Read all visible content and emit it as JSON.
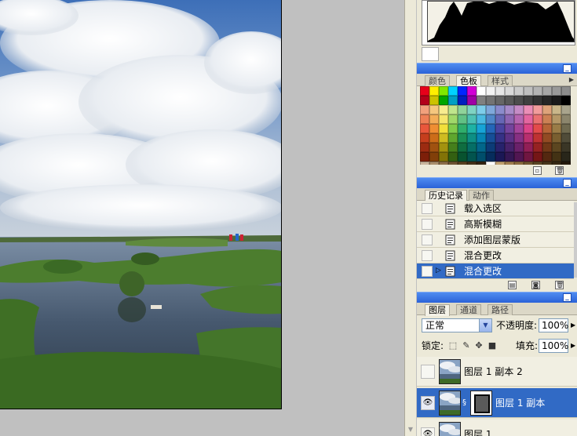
{
  "panels": {
    "swatches": {
      "tabs": [
        "颜色",
        "色板",
        "样式"
      ],
      "active_tab": 1,
      "colors": [
        "#e6001a",
        "#ffee00",
        "#7fe800",
        "#00d2ff",
        "#0026ff",
        "#d100d6",
        "#ffffff",
        "#f2f2f2",
        "#e6e6e6",
        "#d9d9d9",
        "#cccccc",
        "#bfbfbf",
        "#b3b3b3",
        "#a6a6a6",
        "#999999",
        "#8c8c8c",
        "#b3001a",
        "#ccc200",
        "#00a600",
        "#009fc4",
        "#001ebf",
        "#a000a6",
        "#808080",
        "#737373",
        "#666666",
        "#595959",
        "#4d4d4d",
        "#404040",
        "#333333",
        "#262626",
        "#1a1a1a",
        "#000000",
        "#f2a07c",
        "#f5c77e",
        "#f7ec8f",
        "#bfe58c",
        "#8fd39a",
        "#7fd3c3",
        "#7ecdea",
        "#7fa8db",
        "#8b8bcc",
        "#a78bc9",
        "#c68cc6",
        "#eb8eb7",
        "#f29c9c",
        "#dea37a",
        "#c9b68a",
        "#a9a48d",
        "#ee7f56",
        "#f3ad58",
        "#f5e56c",
        "#a0d86a",
        "#61c185",
        "#4ec1b3",
        "#4ab9e1",
        "#4f87c9",
        "#6666b5",
        "#8e66b3",
        "#b666b1",
        "#e466a0",
        "#ea7171",
        "#cc8154",
        "#b49868",
        "#8c866d",
        "#e9573b",
        "#ef8e33",
        "#f2df3b",
        "#80cb4b",
        "#2fae6c",
        "#1eb2a5",
        "#17a4d7",
        "#2466b8",
        "#4a44a0",
        "#74449d",
        "#a3449b",
        "#dc4489",
        "#e34b4b",
        "#b66537",
        "#9a7c47",
        "#6f6a50",
        "#c53e1d",
        "#cc6d19",
        "#cfbc21",
        "#5fa62e",
        "#1a8e55",
        "#0d8f85",
        "#0685b3",
        "#164e97",
        "#363186",
        "#5c3185",
        "#873083",
        "#b82f6f",
        "#bf3232",
        "#934b23",
        "#7a5f30",
        "#504c39",
        "#9c2b11",
        "#a05210",
        "#a3920f",
        "#457f1c",
        "#0f6d40",
        "#056e66",
        "#02668a",
        "#0c3b77",
        "#27226c",
        "#46226a",
        "#6a216a",
        "#911f56",
        "#962222",
        "#713817",
        "#5c4620",
        "#3a3626",
        "#7d1f09",
        "#813f09",
        "#827307",
        "#336011",
        "#08532f",
        "#02544e",
        "#004e6b",
        "#062c5c",
        "#1b1755",
        "#341753",
        "#511652",
        "#701641",
        "#751616",
        "#542810",
        "#433214",
        "#28261a",
        "#c8b49c",
        "#a88e6c",
        "#8b6d48",
        "#6d5332",
        "#57401f",
        "#433118",
        "#332412",
        "#ffffff",
        "#c0a070",
        "#a07d4f",
        "#8a6a3e",
        "#6f5430",
        "#5a4424",
        "#48361b",
        "#362813",
        "#24190b"
      ]
    },
    "history": {
      "tabs": [
        "历史记录",
        "动作"
      ],
      "active_tab": 0,
      "items": [
        "载入选区",
        "高斯模糊",
        "添加图层蒙版",
        "混合更改",
        "混合更改"
      ],
      "selected_index": 4
    },
    "layers": {
      "tabs": [
        "图层",
        "通道",
        "路径"
      ],
      "active_tab": 0,
      "blend_mode": "正常",
      "opacity_label": "不透明度:",
      "opacity_value": "100%",
      "lock_label": "锁定:",
      "fill_label": "填充:",
      "fill_value": "100%",
      "items": [
        {
          "name": "图层 1 副本 2",
          "visible": false,
          "has_mask": false
        },
        {
          "name": "图层 1 副本",
          "visible": true,
          "has_mask": true
        },
        {
          "name": "图层 1",
          "visible": true,
          "has_mask": false
        }
      ],
      "selected_index": 1
    }
  },
  "icons": {
    "minimize": "minimize-icon",
    "menu": "palette-menu-icon",
    "eye": "eye-icon",
    "doc": "history-state-icon",
    "lock_transparent": "lock-transparency-icon",
    "lock_paint": "lock-paint-icon",
    "lock_move": "lock-move-icon",
    "lock_all": "lock-all-icon",
    "new_swatch": "new-swatch-icon",
    "trash": "trash-icon",
    "camera": "new-snapshot-icon",
    "new_doc": "new-document-from-state-icon",
    "chain": "link-chain-icon"
  },
  "colors": {
    "title_bar": "#2a62d8",
    "selection": "#316ac5",
    "panel_bg": "#ece9d8",
    "workspace": "#c0c0c0"
  }
}
